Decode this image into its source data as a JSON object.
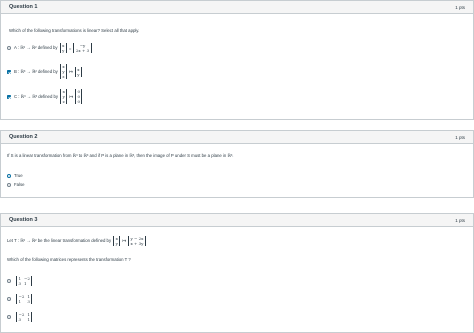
{
  "q1": {
    "title": "Question 1",
    "points": "1 pts",
    "prompt": "Which of the following transformations is linear? Select all that apply.",
    "options": [
      {
        "prefix": "A : ℝ² → ℝ² defined by",
        "in": [
          "x",
          "y"
        ],
        "arrow": "=",
        "out": [
          "−y",
          "2x + 3"
        ],
        "checked": false
      },
      {
        "prefix": "B : ℝ³ → ℝ² defined by",
        "in": [
          "x",
          "y",
          "z"
        ],
        "arrow": "↦",
        "out": [
          "x",
          "y"
        ],
        "checked": true
      },
      {
        "prefix": "C : ℝ³ → ℝ³ defined by",
        "in": [
          "x",
          "y",
          "z"
        ],
        "arrow": "↦",
        "out": [
          "0",
          "0",
          "0"
        ],
        "checked": true
      }
    ]
  },
  "q2": {
    "title": "Question 2",
    "points": "1 pts",
    "prompt": "If S is a linear transformation from ℝ³ to ℝ³ and if P is a plane in ℝ³, then the image of P under S must be a plane in ℝ³.",
    "options": [
      {
        "label": "True",
        "selected": true
      },
      {
        "label": "False",
        "selected": false
      }
    ]
  },
  "q3": {
    "title": "Question 3",
    "points": "1 pts",
    "prompt_a": "Let T : ℝ² → ℝ² be the linear transformation defined by",
    "in": [
      "x",
      "y"
    ],
    "arrow": "↦",
    "out": [
      "y − 2x",
      "x + 3y"
    ],
    "prompt_b": "Which of the following matrices represents the transformation T ?",
    "options": [
      {
        "rows": [
          [
            "1",
            "−2"
          ],
          [
            "3",
            "1"
          ]
        ]
      },
      {
        "rows": [
          [
            "−2",
            "1"
          ],
          [
            "1",
            "3"
          ]
        ]
      },
      {
        "rows": [
          [
            "−2",
            "1"
          ],
          [
            "3",
            "1"
          ]
        ]
      }
    ]
  }
}
